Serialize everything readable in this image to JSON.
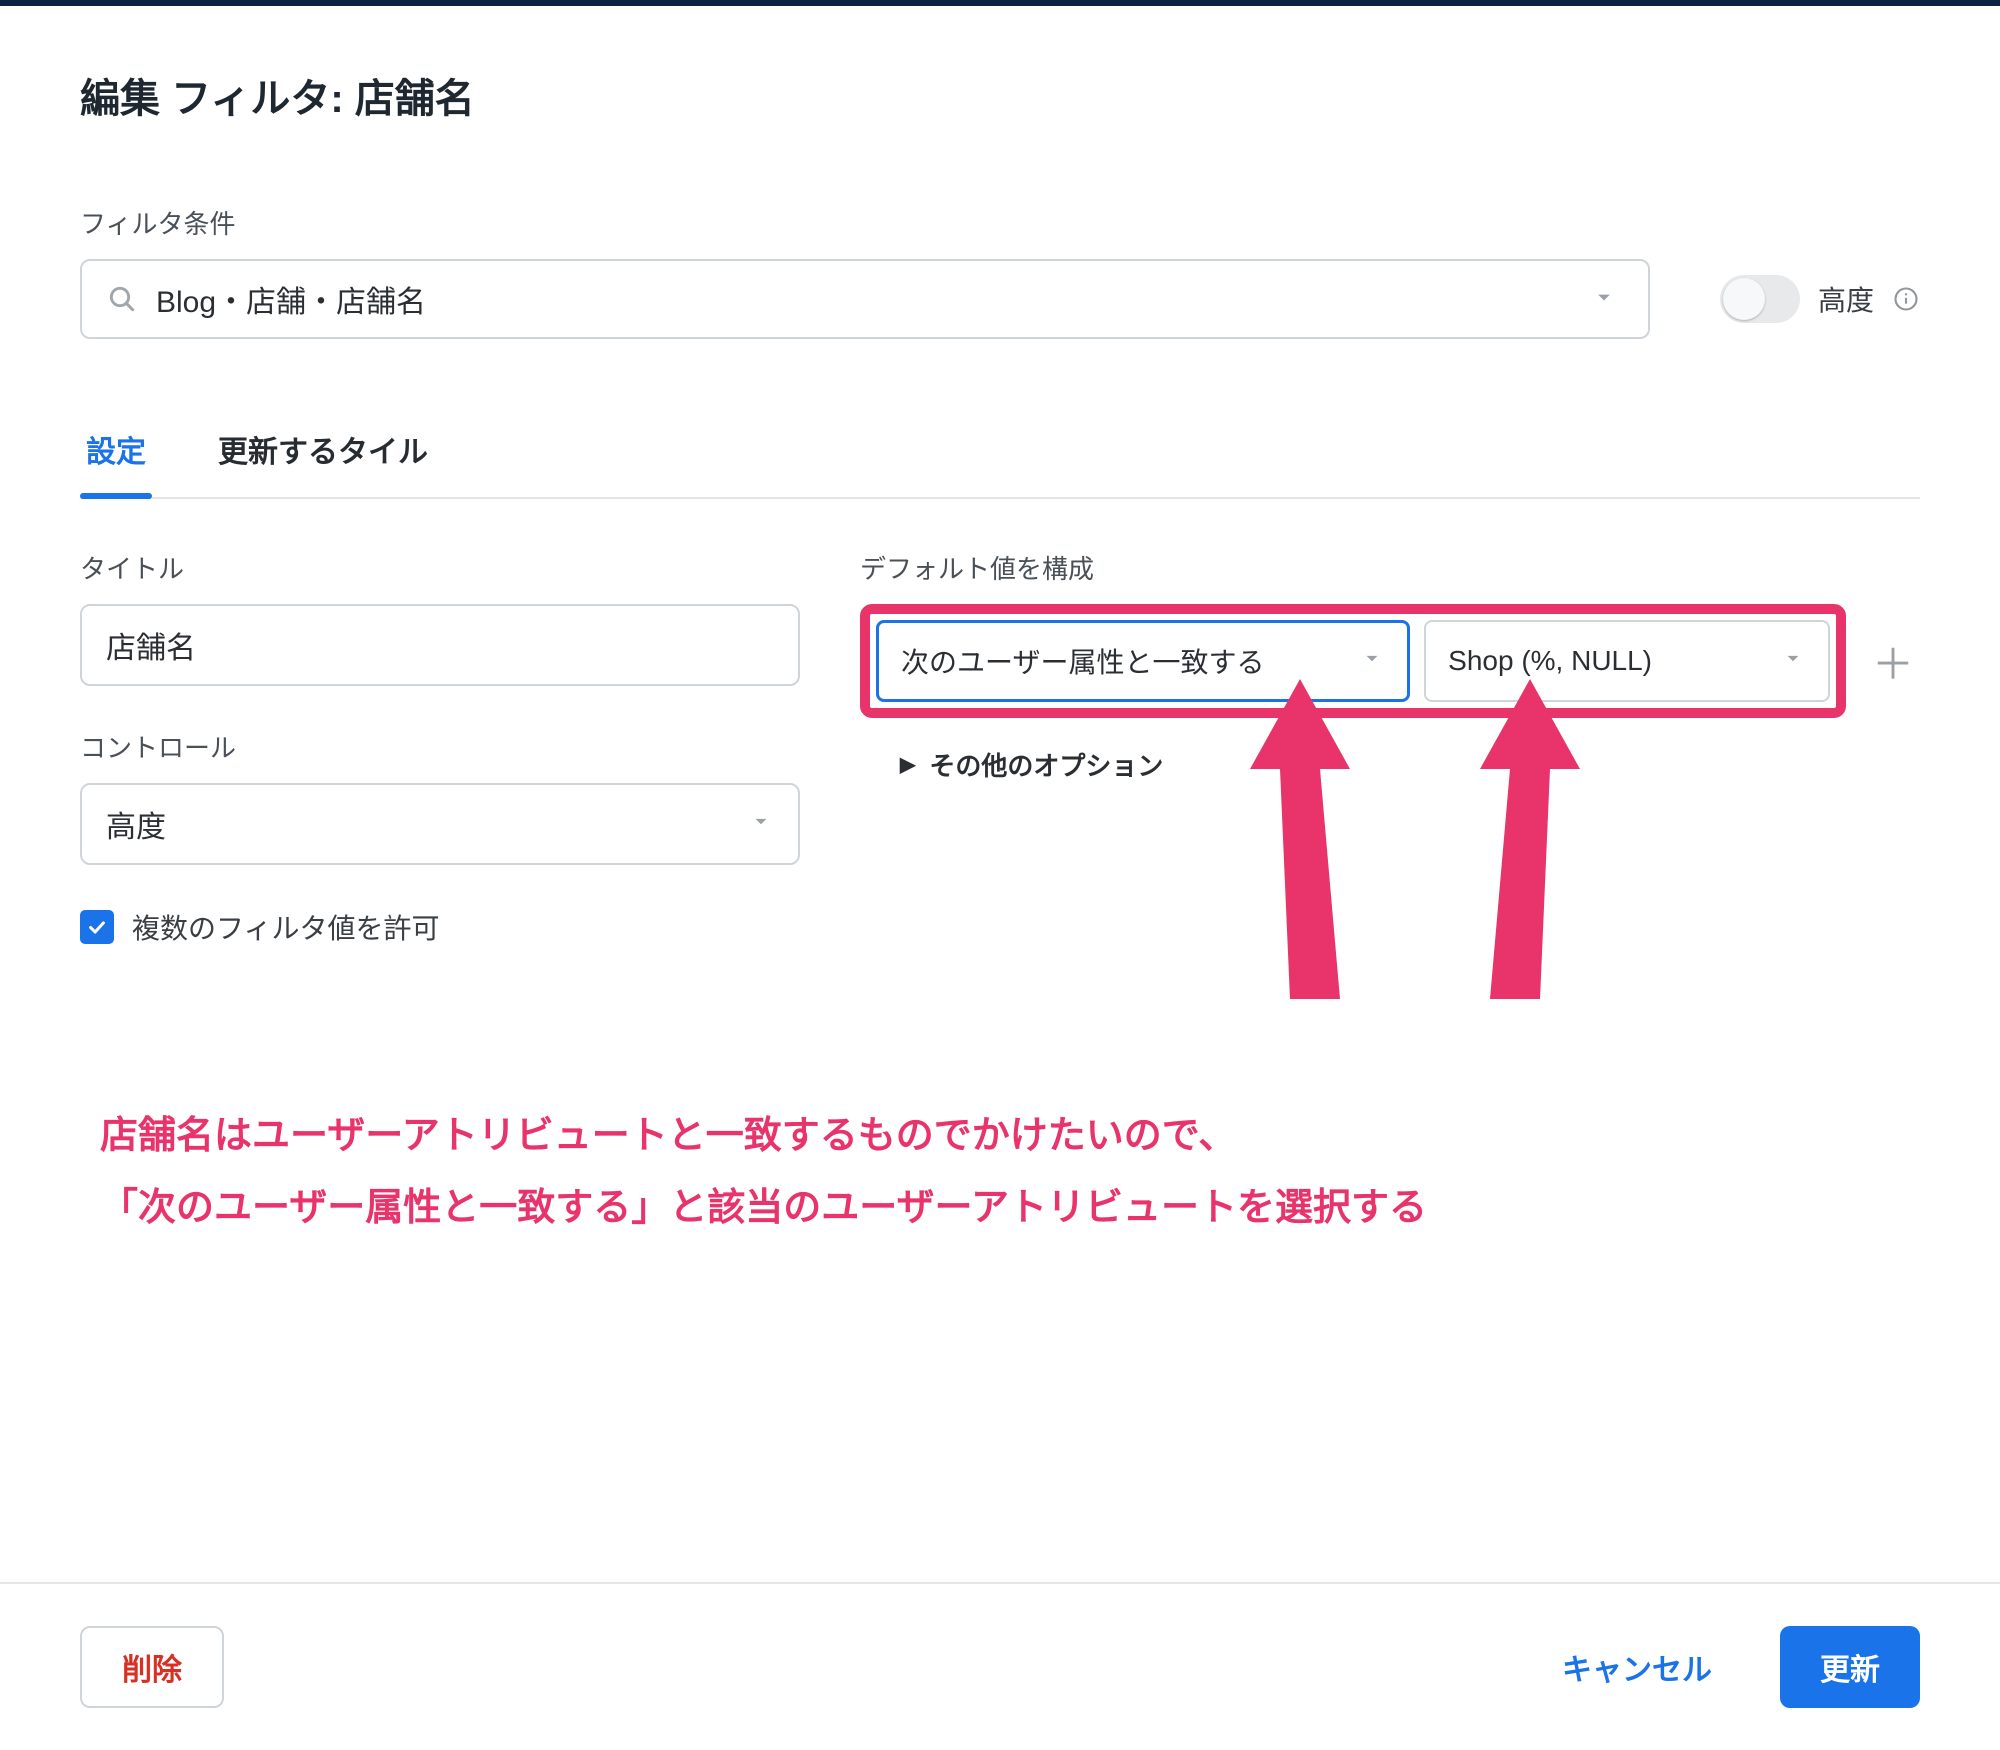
{
  "title": "編集 フィルタ: 店舗名",
  "filter_label": "フィルタ条件",
  "filter_value": "Blog・店舗・店舗名",
  "advanced_label": "高度",
  "tabs": {
    "settings": "設定",
    "tiles": "更新するタイル"
  },
  "left": {
    "title_label": "タイトル",
    "title_value": "店舗名",
    "control_label": "コントロール",
    "control_value": "高度",
    "allow_multi": "複数のフィルタ値を許可"
  },
  "right": {
    "default_label": "デフォルト値を構成",
    "match_value": "次のユーザー属性と一致する",
    "attr_value": "Shop (%, NULL)",
    "other_options": "その他のオプション"
  },
  "annotation": {
    "line1": "店舗名はユーザーアトリビュートと一致するものでかけたいので、",
    "line2": "「次のユーザー属性と一致する」と該当のユーザーアトリビュートを選択する"
  },
  "footer": {
    "delete": "削除",
    "cancel": "キャンセル",
    "update": "更新"
  }
}
